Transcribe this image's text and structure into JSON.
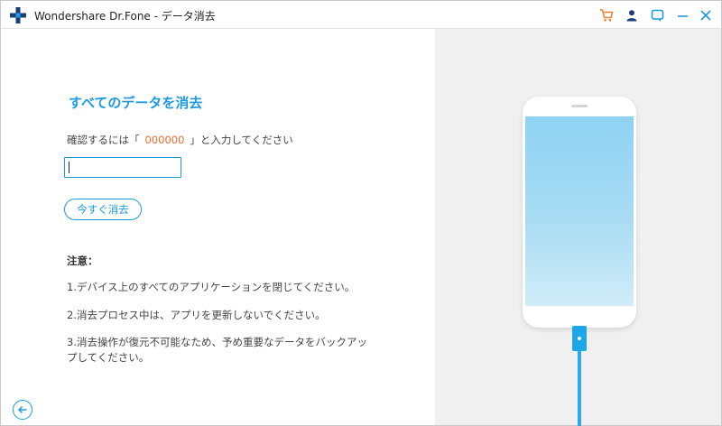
{
  "window": {
    "title": "Wondershare Dr.Fone - データ消去"
  },
  "titlebar": {
    "icons": [
      "cart-icon",
      "account-icon",
      "feedback-icon",
      "minimize-icon",
      "close-icon"
    ]
  },
  "main": {
    "heading": "すべてのデータを消去",
    "confirm_prefix": "確認するには「",
    "confirm_code": "000000",
    "confirm_suffix": "」と入力してください",
    "input_value": "",
    "erase_button": "今すぐ消去",
    "notes_title": "注意：",
    "notes": [
      "1.デバイス上のすべてのアプリケーションを閉じてください。",
      "2.消去プロセス中は、アプリを更新しないでください。",
      "3.消去操作が復元不可能なため、予め重要なデータをバックアップしてください。"
    ]
  },
  "colors": {
    "accent": "#1b9ae0",
    "code": "#f06a2b",
    "cart_icon": "#f07f2b",
    "right_panel": "#f0f0f0"
  }
}
